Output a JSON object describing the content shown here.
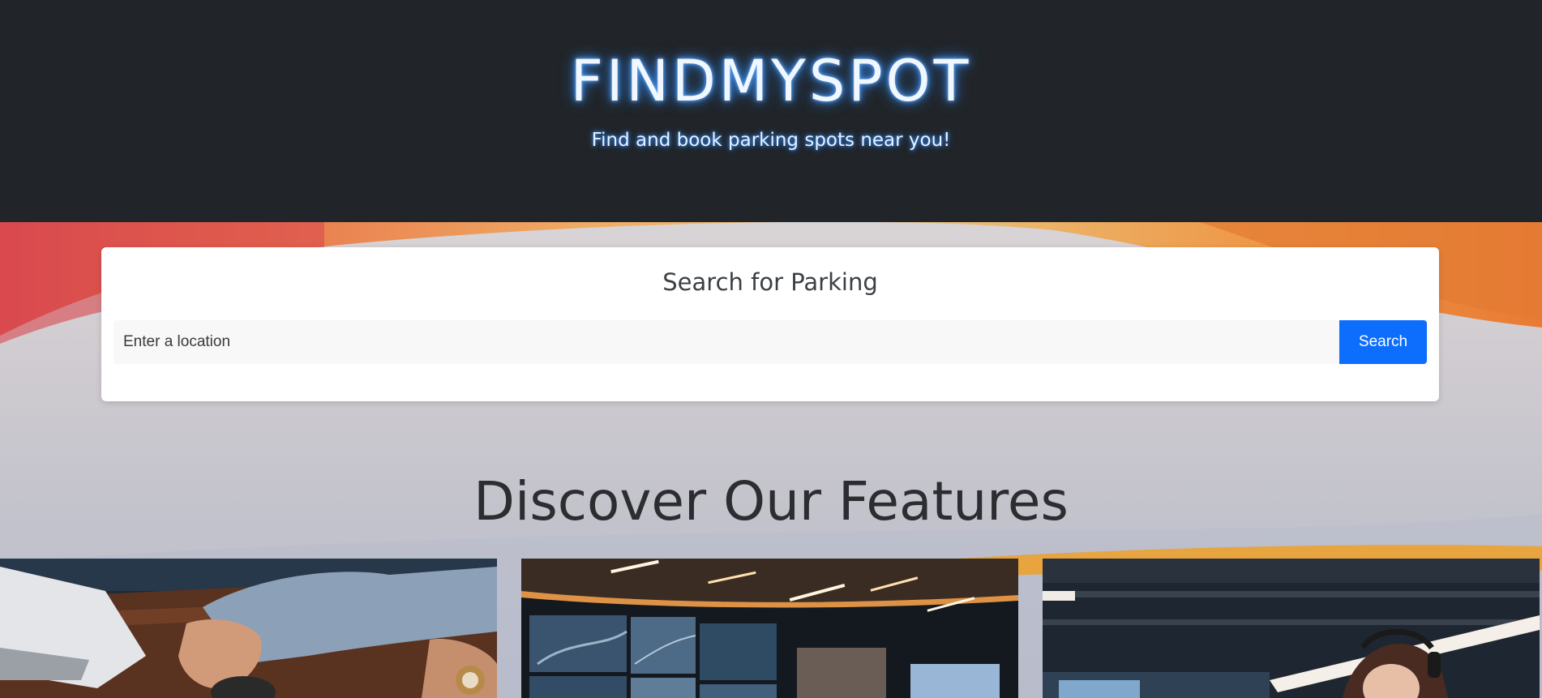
{
  "hero": {
    "title": "FINDMYSPOT",
    "subtitle": "Find and book parking spots near you!"
  },
  "search": {
    "title": "Search for Parking",
    "placeholder": "Enter a location",
    "button_label": "Search"
  },
  "features": {
    "heading": "Discover Our Features",
    "cards": [
      {
        "image": "person-using-laptop-photo"
      },
      {
        "image": "control-room-monitors-photo"
      },
      {
        "image": "support-agent-headset-photo"
      }
    ]
  },
  "colors": {
    "hero_bg": "#212529",
    "accent": "#0d6efd",
    "title_glow": "#3d8ff0"
  }
}
